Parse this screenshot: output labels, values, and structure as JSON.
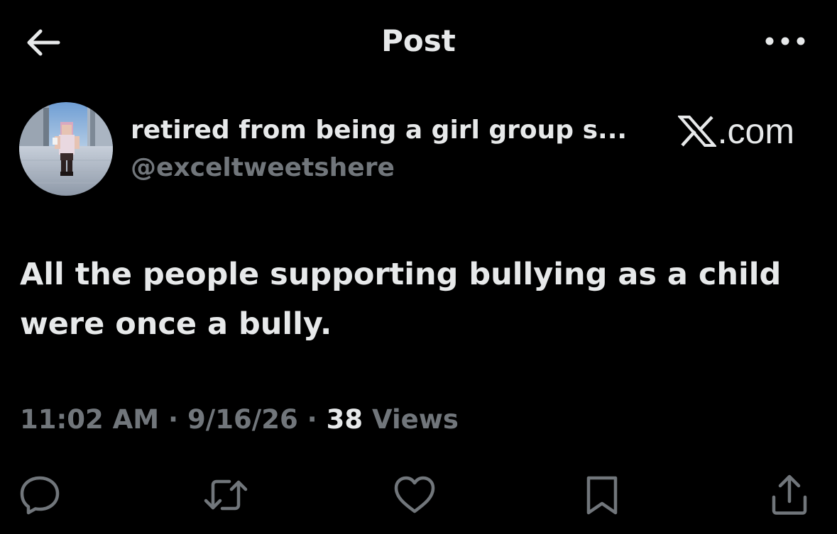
{
  "header": {
    "title": "Post",
    "back_icon": "arrow-left-icon",
    "more_icon": "more-horizontal-icon"
  },
  "post": {
    "display_name": "retired from being a girl group s...",
    "handle": "@exceltweetshere",
    "brand_text": ".com",
    "brand_icon": "x-logo-icon",
    "text": "All the people supporting bullying as a child were once a bully.",
    "time": "11:02 AM",
    "date": "9/16/26",
    "separator": "·",
    "views_count": "38",
    "views_label": "Views"
  },
  "actions": [
    {
      "name": "reply",
      "icon": "reply-icon"
    },
    {
      "name": "repost",
      "icon": "repost-icon"
    },
    {
      "name": "like",
      "icon": "heart-icon"
    },
    {
      "name": "bookmark",
      "icon": "bookmark-icon"
    },
    {
      "name": "share",
      "icon": "share-icon"
    }
  ],
  "colors": {
    "background": "#000000",
    "primary_text": "#e7e9ea",
    "secondary_text": "#71767b"
  }
}
